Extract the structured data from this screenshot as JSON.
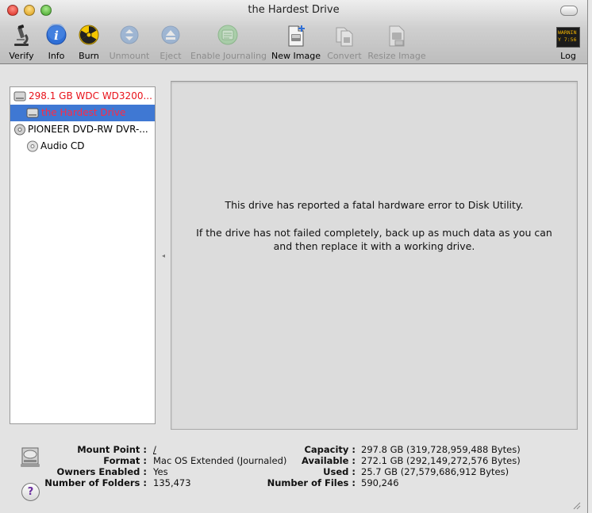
{
  "window": {
    "title": "the Hardest Drive"
  },
  "toolbar": {
    "verify": "Verify",
    "info": "Info",
    "burn": "Burn",
    "unmount": "Unmount",
    "eject": "Eject",
    "enable_journaling": "Enable Journaling",
    "new_image": "New Image",
    "convert": "Convert",
    "resize_image": "Resize Image",
    "log": "Log",
    "log_badge": "WARNIN\nY 7:56"
  },
  "sidebar": {
    "items": [
      {
        "label": "298.1 GB WDC WD3200...",
        "icon": "hard-disk-icon",
        "color": "#e8121a"
      },
      {
        "label": "the Hardest Drive",
        "icon": "volume-icon",
        "color": "#ff2a44",
        "selected": true
      },
      {
        "label": "PIONEER DVD-RW  DVR-...",
        "icon": "optical-drive-icon",
        "color": "#000000"
      },
      {
        "label": "Audio CD",
        "icon": "cd-icon",
        "color": "#000000"
      }
    ]
  },
  "content": {
    "message_line1": "This drive has reported a fatal hardware error to Disk Utility.",
    "message_line2": "If the drive has not failed completely, back up as much data as you can",
    "message_line3": "and then replace it with a working drive."
  },
  "info": {
    "mount_point_label": "Mount Point :",
    "mount_point_value": "/",
    "format_label": "Format :",
    "format_value": "Mac OS Extended (Journaled)",
    "owners_label": "Owners Enabled :",
    "owners_value": "Yes",
    "folders_label": "Number of Folders :",
    "folders_value": "135,473",
    "capacity_label": "Capacity :",
    "capacity_value": "297.8 GB (319,728,959,488 Bytes)",
    "available_label": "Available :",
    "available_value": "272.1 GB (292,149,272,576 Bytes)",
    "used_label": "Used :",
    "used_value": "25.7 GB (27,579,686,912 Bytes)",
    "files_label": "Number of Files :",
    "files_value": "590,246",
    "help": "?"
  }
}
